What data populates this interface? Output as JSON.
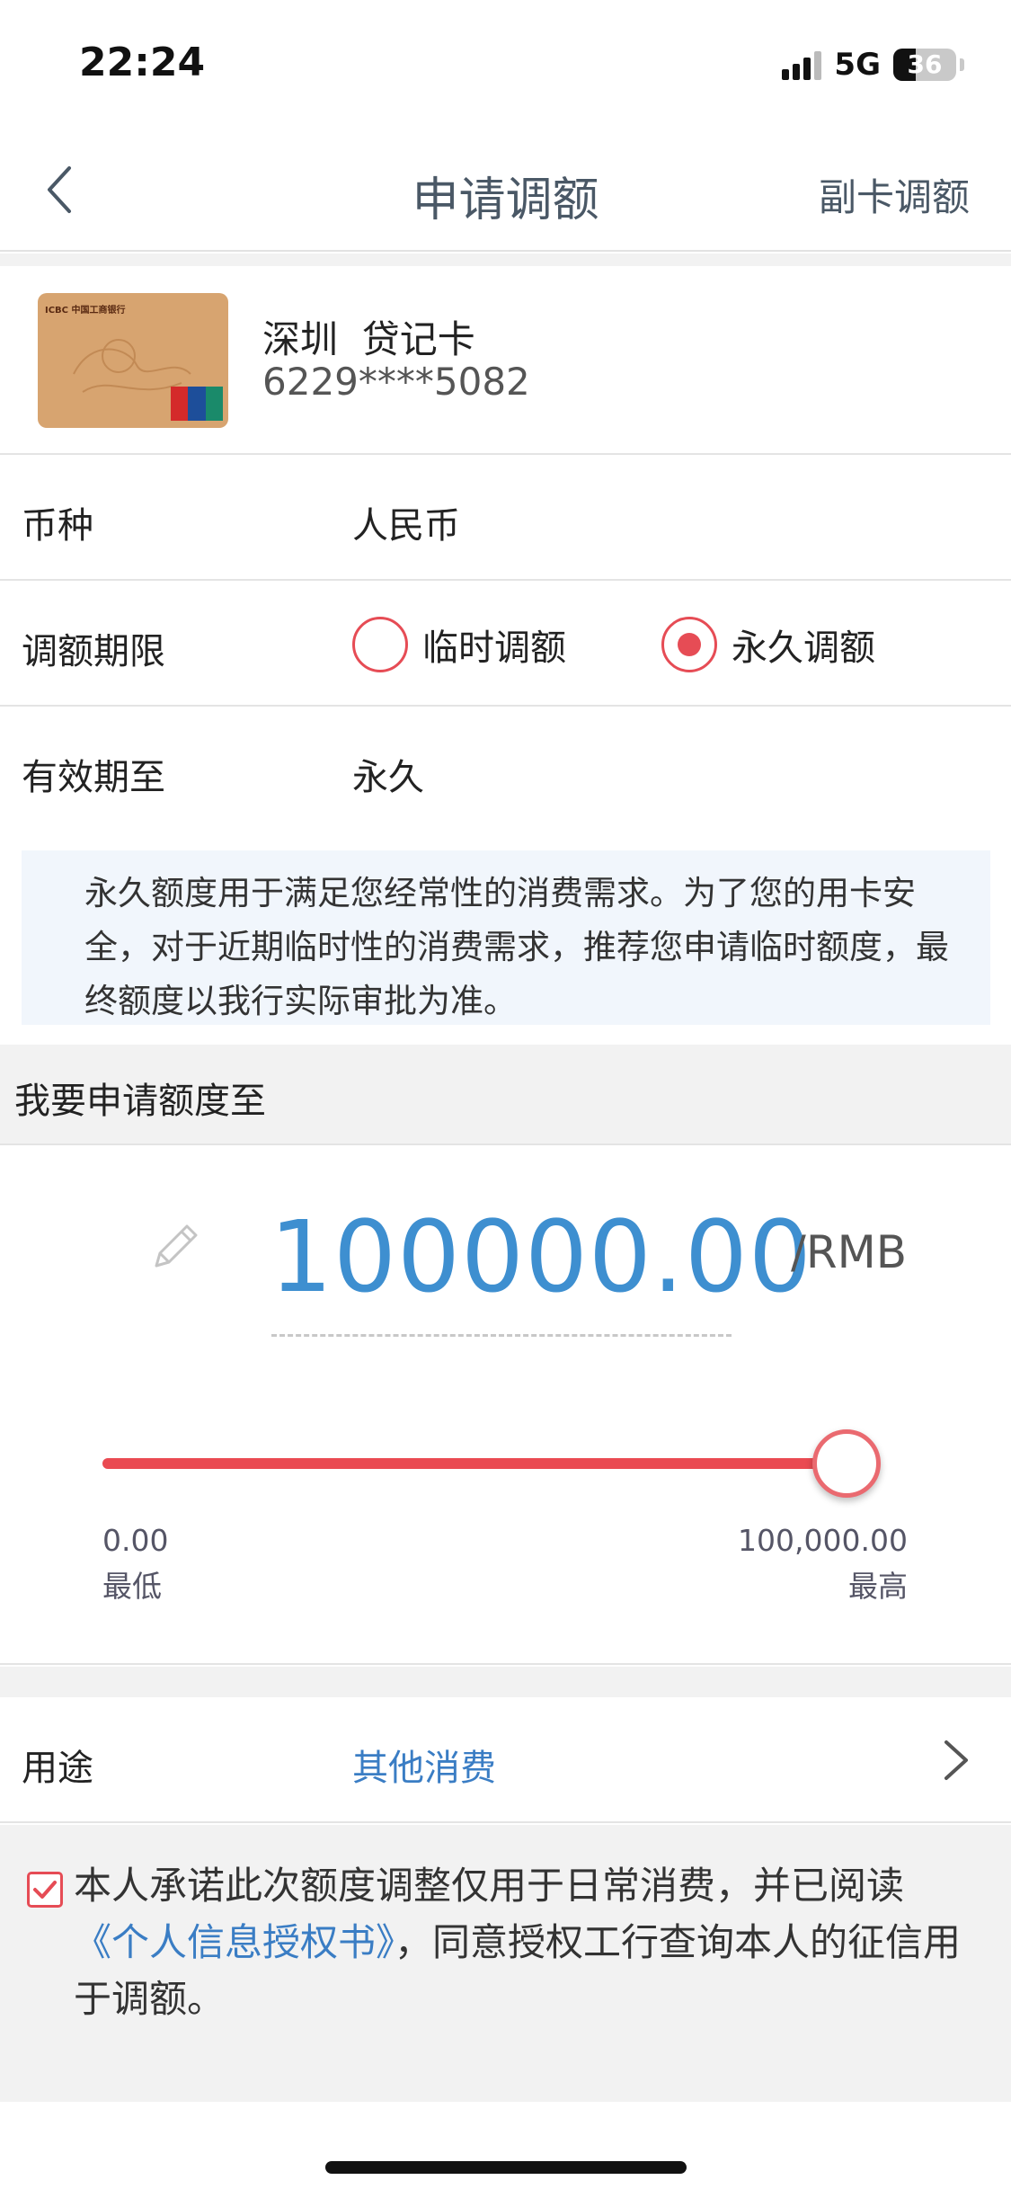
{
  "status_bar": {
    "time": "22:24",
    "network": "5G",
    "battery": "36",
    "battery_level": 0.36,
    "icons": [
      "signal-icon",
      "battery-icon"
    ]
  },
  "nav": {
    "back_icon": "chevron-left-icon",
    "title": "申请调额",
    "right_action": "副卡调额"
  },
  "card": {
    "name": "深圳  贷记卡",
    "number": "6229****5082",
    "card_image_text": "ICBC  中国工商银行"
  },
  "currency": {
    "label": "币种",
    "value": "人民币"
  },
  "period": {
    "label": "调额期限",
    "options": [
      {
        "label": "临时调额",
        "selected": false
      },
      {
        "label": "永久调额",
        "selected": true
      }
    ]
  },
  "validity": {
    "label": "有效期至",
    "value": "永久"
  },
  "notice": {
    "text": "永久额度用于满足您经常性的消费需求。为了您的用卡安全，对于近期临时性的消费需求，推荐您申请临时额度，最终额度以我行实际审批为准。"
  },
  "amount_section": {
    "heading": "我要申请额度至",
    "amount": "100000.00",
    "unit": "/RMB",
    "slider": {
      "value": 100000,
      "min": 0,
      "max": 100000,
      "min_value_text": "0.00",
      "min_label": "最低",
      "max_value_text": "100,000.00",
      "max_label": "最高"
    }
  },
  "purpose": {
    "label": "用途",
    "value": "其他消费"
  },
  "agreement": {
    "checked": true,
    "text_before": "本人承诺此次额度调整仅用于日常消费，并已阅读",
    "link": "《个人信息授权书》",
    "text_after": "，同意授权工行查询本人的征信用于调额。"
  },
  "colors": {
    "accent_red": "#e64c55",
    "amount_blue": "#3e8fd0",
    "link_blue": "#3a7dc4",
    "notice_bg": "#f1f6fc"
  }
}
